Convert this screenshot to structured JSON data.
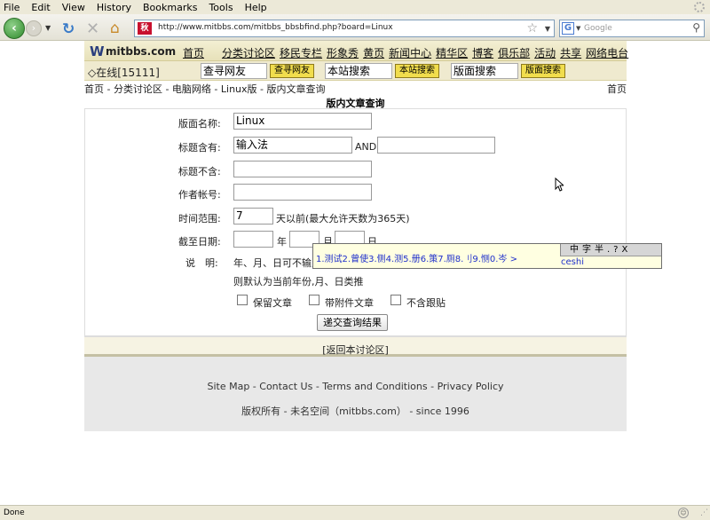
{
  "browser": {
    "menu": [
      "File",
      "Edit",
      "View",
      "History",
      "Bookmarks",
      "Tools",
      "Help"
    ],
    "favicon_text": "秋",
    "url": "http://www.mitbbs.com/mitbbs_bbsbfind.php?board=Linux",
    "search_engine": "G",
    "search_placeholder": "Google",
    "status": "Done"
  },
  "site": {
    "logo_mark": "W",
    "logo_text": "mitbbs.com",
    "nav": [
      "首页",
      "分类讨论区",
      "移民专栏",
      "形象秀",
      "黄页",
      "新闻中心",
      "精华区",
      "博客",
      "俱乐部",
      "活动",
      "共享",
      "网络电台"
    ],
    "online": "◇在线[15111]",
    "search": {
      "user_value": "查寻网友",
      "user_btn": "查寻网友",
      "site_value": "本站搜索",
      "site_btn": "本站搜索",
      "board_value": "版面搜索",
      "board_btn": "版面搜索"
    },
    "breadcrumb": "首页 - 分类讨论区 - 电脑网络 - Linux版 - 版内文章查询",
    "breadcrumb_right": "首页"
  },
  "form": {
    "title": "版内文章查询",
    "board_label": "版面名称:",
    "board_value": "Linux",
    "title_has_label": "标题含有:",
    "title_has_value": "输入法",
    "and_label": "AND",
    "title_has_value2": "",
    "title_not_label": "标题不含:",
    "title_not_value": "",
    "author_label": "作者帐号:",
    "author_value": "",
    "range_label": "时间范围:",
    "range_value": "7",
    "range_suffix": "天以前(最大允许天数为365天)",
    "date_label": "截至日期:",
    "year_value": "",
    "year_unit": "年",
    "month_value": "",
    "month_unit": "月",
    "day_value": "",
    "day_unit": "日",
    "note_label": "说　明:",
    "note_line1": "年、月、日可不输入",
    "note_line2": "则默认为当前年份,月、日类推",
    "check_keep": "保留文章",
    "check_attach": "带附件文章",
    "check_noreply": "不含跟贴",
    "submit_label": "递交查询结果"
  },
  "back_link": "[返回本讨论区]",
  "footer": {
    "links": "Site Map - Contact Us - Terms and Conditions - Privacy Policy",
    "copyright": "版权所有 - 未名空间（mitbbs.com） - since 1996"
  },
  "ime": {
    "candidates": "1.测试2.曾使3.侧4.测5.册6.策7.厕8.刂9.恻0.岑 >",
    "toolbar": "中字半.?X",
    "composition": "ceshi"
  }
}
